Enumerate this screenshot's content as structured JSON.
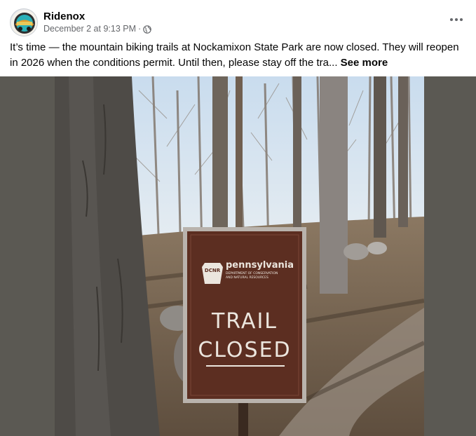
{
  "post": {
    "author": "Ridenox",
    "timestamp": "December 2 at 9:13 PM",
    "separator": "·",
    "audience_icon": "globe-icon",
    "more_icon": "more-options-icon",
    "caption": "It’s time — the mountain biking trails at Nockamixon State Park are now closed. They will reopen in 2026 when the conditions permit. Until then, please stay off the tra...",
    "see_more": "See more"
  },
  "photo": {
    "description_icon": "trail-closed-photo",
    "sign": {
      "brand": "pennsylvania",
      "dept_line1": "DEPARTMENT OF CONSERVATION",
      "dept_line2": "AND NATURAL RESOURCES",
      "badge": "DCNR",
      "line1": "TRAIL",
      "line2": "CLOSED"
    }
  },
  "colors": {
    "text_primary": "#050505",
    "text_secondary": "#65676b",
    "sign_brown": "#5c2e21",
    "sign_border": "#b9b3ad"
  }
}
